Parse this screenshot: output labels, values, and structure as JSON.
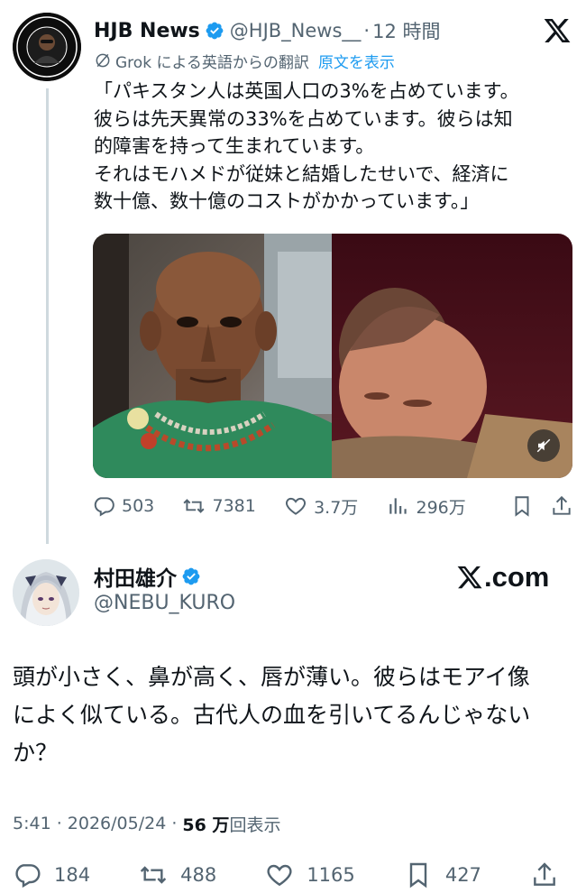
{
  "quoted_tweet": {
    "author_name": "HJB News",
    "handle": "@HJB_News__",
    "separator": "·",
    "time": "12 時間",
    "translation_label": "Grok による英語からの翻訳",
    "show_original": "原文を表示",
    "body_lines": [
      "「パキスタン人は英国人口の3%を占めています。",
      "彼らは先天異常の33%を占めています。彼らは知",
      "的障害を持って生まれています。",
      "それはモハメドが従妹と結婚したせいで、経済に",
      "数十億、数十億のコストがかかっています。」"
    ],
    "actions": {
      "replies": "503",
      "reposts": "7381",
      "likes": "3.7万",
      "views": "296万"
    },
    "icons": [
      "reply-icon",
      "repost-icon",
      "like-icon",
      "views-icon",
      "bookmark-icon",
      "share-icon",
      "mute-icon",
      "x-logo-icon",
      "verified-badge-icon",
      "translate-icon"
    ]
  },
  "main_tweet": {
    "author_name": "村田雄介",
    "handle": "@NEBU_KURO",
    "watermark": ".com",
    "body_lines": [
      "頭が小さく、鼻が高く、唇が薄い。彼らはモアイ像",
      "によく似ている。古代人の血を引いてるんじゃない",
      "か？"
    ],
    "timestamp": "5:41 · 2026/05/24 ·",
    "views": "56 万",
    "views_label": "回表示",
    "actions": {
      "replies": "184",
      "reposts": "488",
      "likes": "1165",
      "bookmarks": "427"
    }
  },
  "colors": {
    "text_primary": "#0f1419",
    "text_secondary": "#536471",
    "accent_blue": "#1d9bf0",
    "thread_line": "#cfd9de"
  }
}
